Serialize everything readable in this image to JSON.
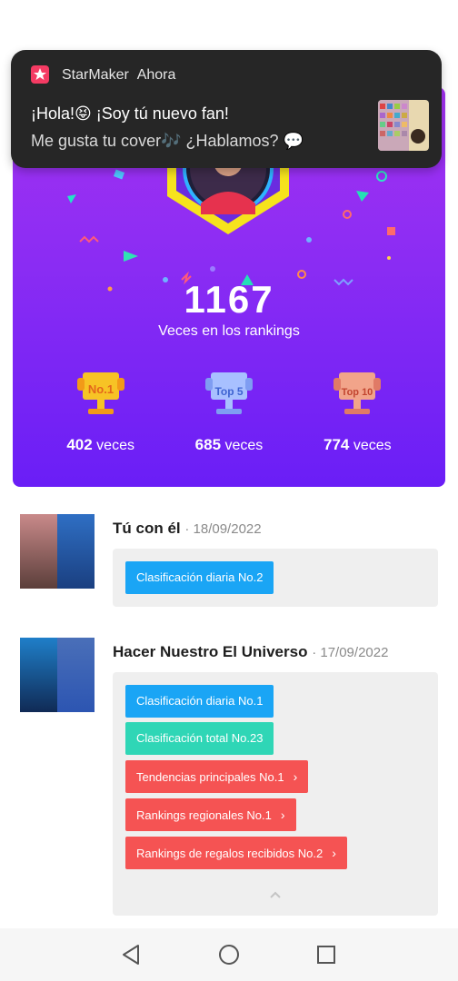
{
  "notification": {
    "app_name": "StarMaker",
    "time": "Ahora",
    "title": "¡Hola!😝 ¡Soy tú nuevo fan!",
    "body": "Me gusta tu cover🎶 ¿Hablamos? 💬"
  },
  "rankings": {
    "total_count": "1167",
    "total_label": "Veces en los rankings",
    "trophies": [
      {
        "badge": "No.1",
        "value": "402",
        "unit": "veces",
        "color": "#f7c325"
      },
      {
        "badge": "Top 5",
        "value": "685",
        "unit": "veces",
        "color": "#a8c0ff"
      },
      {
        "badge": "Top 10",
        "value": "774",
        "unit": "veces",
        "color": "#f2a48a"
      }
    ]
  },
  "feed": [
    {
      "song": "Tú con él",
      "date": "· 18/09/2022",
      "tags": [
        {
          "label": "Clasificación diaria No.2",
          "color": "blue"
        }
      ]
    },
    {
      "song": "Hacer Nuestro El Universo",
      "date": "· 17/09/2022",
      "tags": [
        {
          "label": "Clasificación diaria No.1",
          "color": "blue"
        },
        {
          "label": "Clasificación total No.23",
          "color": "teal"
        },
        {
          "label": "Tendencias principales No.1",
          "color": "red",
          "chevron": "›"
        },
        {
          "label": "Rankings regionales No.1",
          "color": "red",
          "chevron": "›"
        },
        {
          "label": "Rankings de regalos recibidos No.2",
          "color": "red",
          "chevron": "›"
        }
      ]
    }
  ],
  "navbar": {
    "icons": [
      "back-triangle-icon",
      "home-circle-icon",
      "recents-square-icon"
    ]
  }
}
